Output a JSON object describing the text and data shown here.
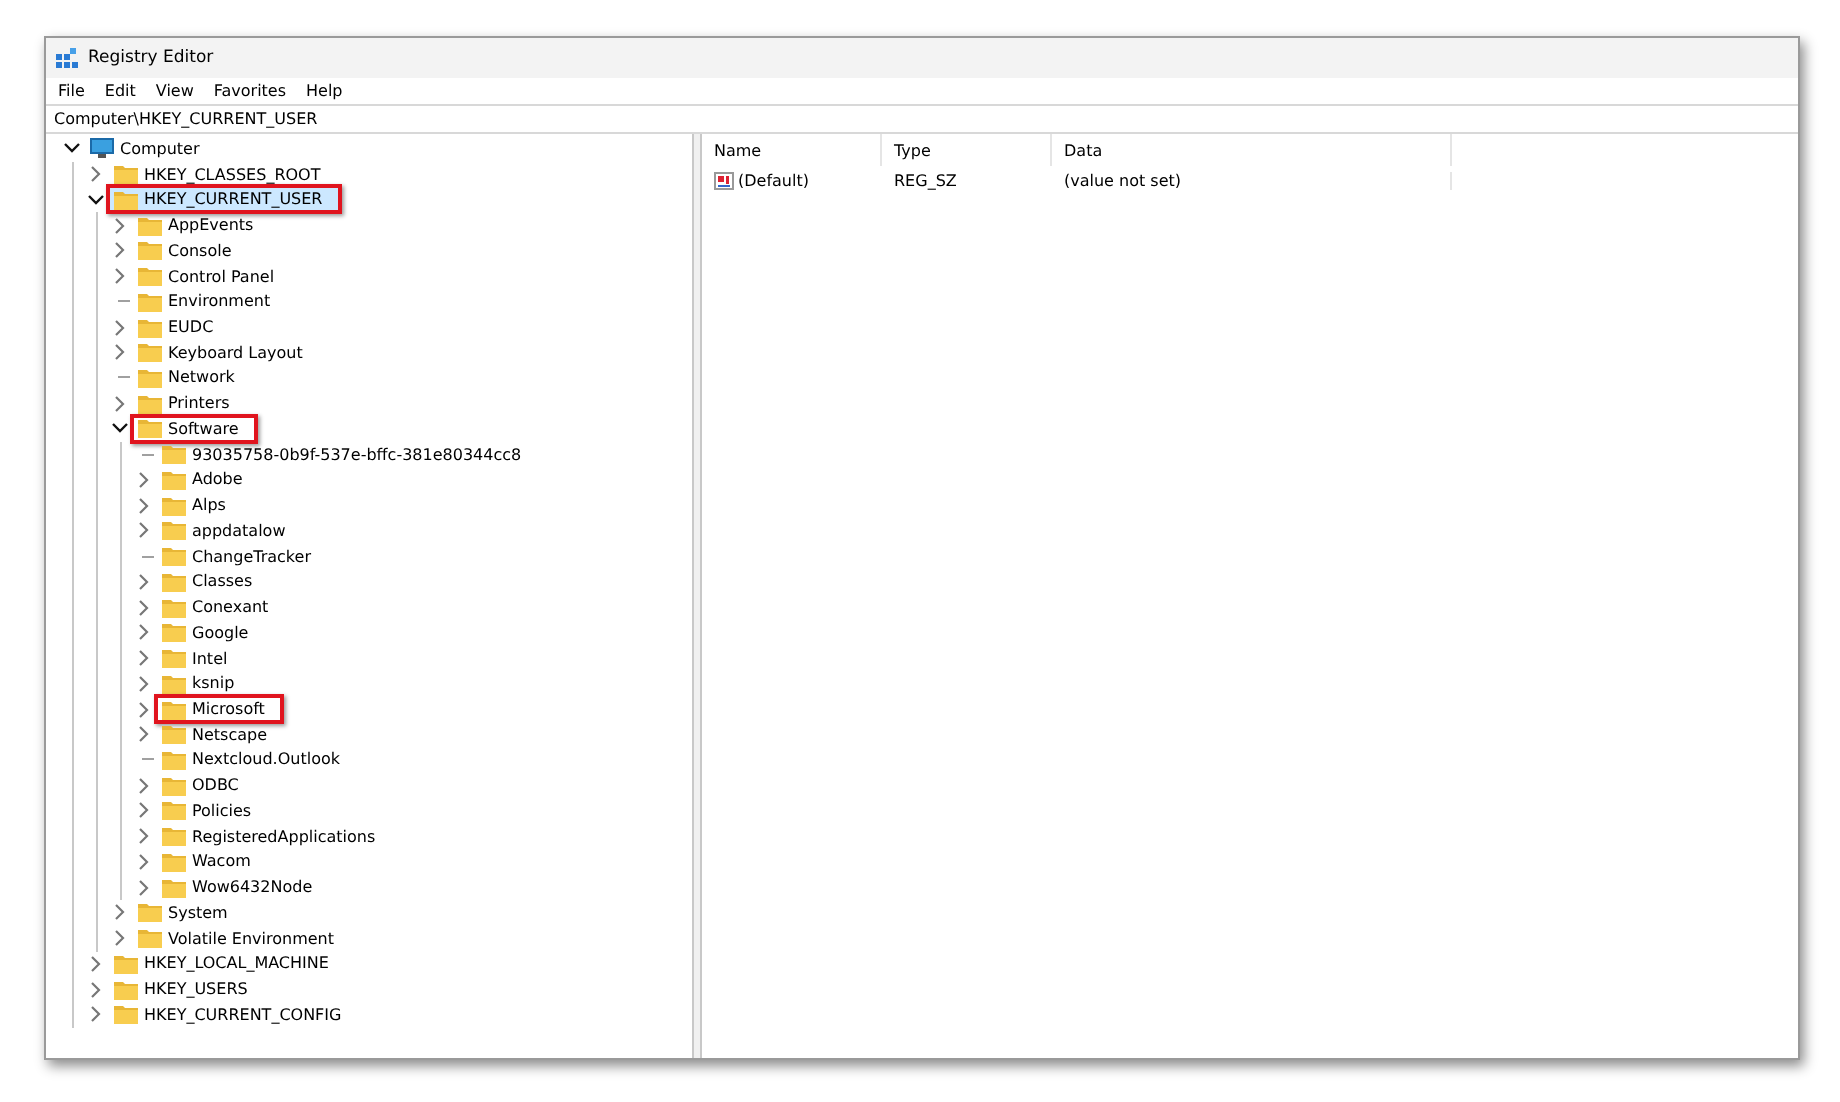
{
  "window": {
    "title": "Registry Editor"
  },
  "menu": [
    "File",
    "Edit",
    "View",
    "Favorites",
    "Help"
  ],
  "address": {
    "value": "Computer\\HKEY_CURRENT_USER"
  },
  "tree": [
    {
      "label": "Computer",
      "kind": "computer",
      "expandable": true,
      "expanded": true,
      "selected": false,
      "highlighted": false,
      "children": [
        {
          "label": "HKEY_CLASSES_ROOT",
          "kind": "folder",
          "expandable": true,
          "expanded": false,
          "selected": false,
          "highlighted": false
        },
        {
          "label": "HKEY_CURRENT_USER",
          "kind": "folder",
          "expandable": true,
          "expanded": true,
          "selected": true,
          "highlighted": true,
          "children": [
            {
              "label": "AppEvents",
              "kind": "folder",
              "expandable": true,
              "expanded": false,
              "selected": false,
              "highlighted": false
            },
            {
              "label": "Console",
              "kind": "folder",
              "expandable": true,
              "expanded": false,
              "selected": false,
              "highlighted": false
            },
            {
              "label": "Control Panel",
              "kind": "folder",
              "expandable": true,
              "expanded": false,
              "selected": false,
              "highlighted": false
            },
            {
              "label": "Environment",
              "kind": "folder",
              "expandable": false,
              "selected": false,
              "highlighted": false
            },
            {
              "label": "EUDC",
              "kind": "folder",
              "expandable": true,
              "expanded": false,
              "selected": false,
              "highlighted": false
            },
            {
              "label": "Keyboard Layout",
              "kind": "folder",
              "expandable": true,
              "expanded": false,
              "selected": false,
              "highlighted": false
            },
            {
              "label": "Network",
              "kind": "folder",
              "expandable": false,
              "selected": false,
              "highlighted": false
            },
            {
              "label": "Printers",
              "kind": "folder",
              "expandable": true,
              "expanded": false,
              "selected": false,
              "highlighted": false
            },
            {
              "label": "Software",
              "kind": "folder",
              "expandable": true,
              "expanded": true,
              "selected": false,
              "highlighted": true,
              "children": [
                {
                  "label": "93035758-0b9f-537e-bffc-381e80344cc8",
                  "kind": "folder",
                  "expandable": false,
                  "selected": false,
                  "highlighted": false
                },
                {
                  "label": "Adobe",
                  "kind": "folder",
                  "expandable": true,
                  "expanded": false,
                  "selected": false,
                  "highlighted": false
                },
                {
                  "label": "Alps",
                  "kind": "folder",
                  "expandable": true,
                  "expanded": false,
                  "selected": false,
                  "highlighted": false
                },
                {
                  "label": "appdatalow",
                  "kind": "folder",
                  "expandable": true,
                  "expanded": false,
                  "selected": false,
                  "highlighted": false
                },
                {
                  "label": "ChangeTracker",
                  "kind": "folder",
                  "expandable": false,
                  "selected": false,
                  "highlighted": false
                },
                {
                  "label": "Classes",
                  "kind": "folder",
                  "expandable": true,
                  "expanded": false,
                  "selected": false,
                  "highlighted": false
                },
                {
                  "label": "Conexant",
                  "kind": "folder",
                  "expandable": true,
                  "expanded": false,
                  "selected": false,
                  "highlighted": false
                },
                {
                  "label": "Google",
                  "kind": "folder",
                  "expandable": true,
                  "expanded": false,
                  "selected": false,
                  "highlighted": false
                },
                {
                  "label": "Intel",
                  "kind": "folder",
                  "expandable": true,
                  "expanded": false,
                  "selected": false,
                  "highlighted": false
                },
                {
                  "label": "ksnip",
                  "kind": "folder",
                  "expandable": true,
                  "expanded": false,
                  "selected": false,
                  "highlighted": false
                },
                {
                  "label": "Microsoft",
                  "kind": "folder",
                  "expandable": true,
                  "expanded": false,
                  "selected": false,
                  "highlighted": true
                },
                {
                  "label": "Netscape",
                  "kind": "folder",
                  "expandable": true,
                  "expanded": false,
                  "selected": false,
                  "highlighted": false
                },
                {
                  "label": "Nextcloud.Outlook",
                  "kind": "folder",
                  "expandable": false,
                  "selected": false,
                  "highlighted": false
                },
                {
                  "label": "ODBC",
                  "kind": "folder",
                  "expandable": true,
                  "expanded": false,
                  "selected": false,
                  "highlighted": false
                },
                {
                  "label": "Policies",
                  "kind": "folder",
                  "expandable": true,
                  "expanded": false,
                  "selected": false,
                  "highlighted": false
                },
                {
                  "label": "RegisteredApplications",
                  "kind": "folder",
                  "expandable": true,
                  "expanded": false,
                  "selected": false,
                  "highlighted": false
                },
                {
                  "label": "Wacom",
                  "kind": "folder",
                  "expandable": true,
                  "expanded": false,
                  "selected": false,
                  "highlighted": false
                },
                {
                  "label": "Wow6432Node",
                  "kind": "folder",
                  "expandable": true,
                  "expanded": false,
                  "selected": false,
                  "highlighted": false
                }
              ]
            },
            {
              "label": "System",
              "kind": "folder",
              "expandable": true,
              "expanded": false,
              "selected": false,
              "highlighted": false
            },
            {
              "label": "Volatile Environment",
              "kind": "folder",
              "expandable": true,
              "expanded": false,
              "selected": false,
              "highlighted": false
            }
          ]
        },
        {
          "label": "HKEY_LOCAL_MACHINE",
          "kind": "folder",
          "expandable": true,
          "expanded": false,
          "selected": false,
          "highlighted": false
        },
        {
          "label": "HKEY_USERS",
          "kind": "folder",
          "expandable": true,
          "expanded": false,
          "selected": false,
          "highlighted": false
        },
        {
          "label": "HKEY_CURRENT_CONFIG",
          "kind": "folder",
          "expandable": true,
          "expanded": false,
          "selected": false,
          "highlighted": false
        }
      ]
    }
  ],
  "values": {
    "columns": [
      "Name",
      "Type",
      "Data"
    ],
    "rows": [
      {
        "name": "(Default)",
        "type": "REG_SZ",
        "data": "(value not set)"
      }
    ]
  }
}
